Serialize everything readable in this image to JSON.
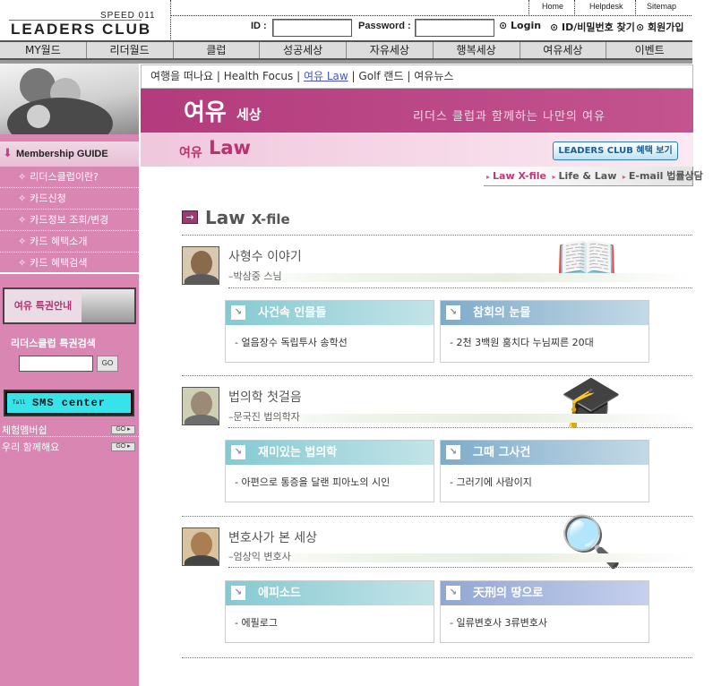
{
  "brand": {
    "speed": "SPEED 011",
    "name": "LEADERS CLUB"
  },
  "util_links": [
    "Home",
    "Helpdesk",
    "Sitemap"
  ],
  "login": {
    "id_label": "ID :",
    "password_label": "Password :",
    "login_label": "Login",
    "find_label": "ID/비밀번호 찾기",
    "join_label": "회원가입"
  },
  "nav": [
    "MY월드",
    "리더월드",
    "클럽",
    "성공세상",
    "자유세상",
    "행복세상",
    "여유세상",
    "이벤트"
  ],
  "sidebar": {
    "guide_title": "Membership GUIDE",
    "items": [
      "리더스클럽이란?",
      "카드신청",
      "카드정보 조회/변경",
      "카드 혜택소개",
      "카드 혜택검색"
    ],
    "benefit_label": "여유 특권안내",
    "search_label": "리더스클럽 특권검색",
    "go_label": "GO",
    "sms_label": "SMS center",
    "sms_signal": "Tall",
    "bottom_links": [
      "체험멤버쉽",
      "우리 함께해요"
    ],
    "mini_go": "GO ▸"
  },
  "subnav": {
    "items": [
      "여행을 떠나요",
      "Health Focus",
      "여유 Law",
      "Golf 랜드",
      "여유뉴스"
    ],
    "separator": "|"
  },
  "banner": {
    "title": "여유",
    "subtitle": "세상",
    "tagline": "리더스 클럽과 함께하는 나만의 여유"
  },
  "law_bar": {
    "prefix": "여유",
    "title": "Law",
    "button_label": "LEADERS CLUB 혜택 보기"
  },
  "tabs": {
    "items": [
      "Law X-file",
      "Life & Law",
      "E-mail 법률상담"
    ],
    "bullet": "▸"
  },
  "xfile": {
    "icon": "→",
    "title": "Law",
    "title_small": "X-file"
  },
  "sections": [
    {
      "title": "사형수 이야기",
      "author": "–박삼중 스님",
      "cards": [
        {
          "head": "사건속 인물들",
          "text": "- 얼음장수 독립투사 송학선"
        },
        {
          "head": "참회의 눈물",
          "text": "- 2천 3백원 훔치다 누님찌른 20대"
        }
      ]
    },
    {
      "title": "법의학 첫걸음",
      "author": "–문국진 법의학자",
      "cards": [
        {
          "head": "재미있는 법의학",
          "text": "- 아편으로 통증을 달랜 피아노의 시인"
        },
        {
          "head": "그때 그사건",
          "text": "- 그러기에 사람이지"
        }
      ]
    },
    {
      "title": "변호사가 본 세상",
      "author": "–엄상익 변호사",
      "cards": [
        {
          "head": "에피소드",
          "text": "- 에필로그"
        },
        {
          "head": "天刑의 땅으로",
          "text": "- 일류변호사 3류변호사"
        }
      ]
    }
  ],
  "card_icon": "↘",
  "colors": {
    "magenta": "#b33b7d",
    "sidebar": "#d986b2",
    "teal": "#86c9d1",
    "steel": "#7eabc9",
    "blue": "#92a6d4"
  }
}
